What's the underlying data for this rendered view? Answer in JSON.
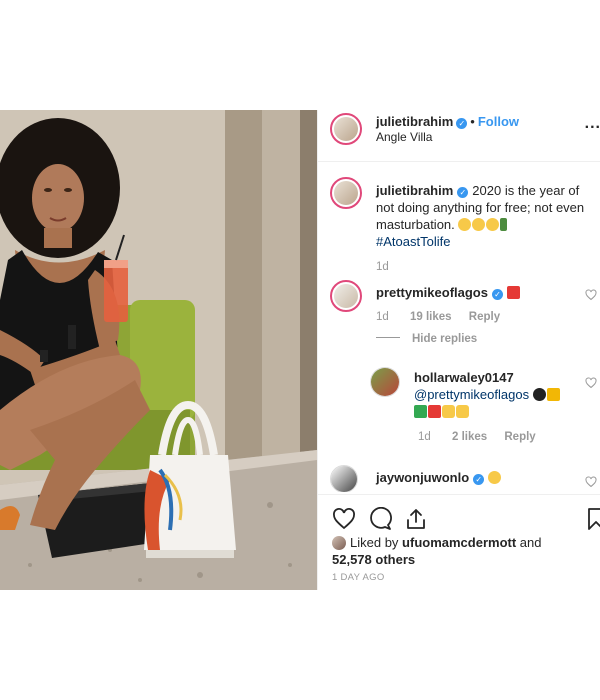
{
  "post": {
    "author": "julietibrahim",
    "follow_label": "Follow",
    "dot": "•",
    "location": "Angle Villa",
    "more_label": "..."
  },
  "caption": {
    "username": "julietibrahim",
    "text": "2020 is the year of not doing anything for free; not even masturbation.",
    "emojis": [
      "thinking-face-emoji",
      "neutral-face-emoji",
      "grinning-face-emoji",
      "bottle-emoji"
    ],
    "hashtag": "#AtoastTolife",
    "time": "1d"
  },
  "comments": [
    {
      "username": "prettymikeoflagos",
      "verified": true,
      "emoji": "hundred-points-emoji",
      "time": "1d",
      "likes": "19 likes",
      "reply_label": "Reply",
      "hide_replies_label": "Hide replies",
      "replies": [
        {
          "username": "hollarwaley0147",
          "mention": "@prettymikeoflagos",
          "emojis": [
            "black-heart-emoji",
            "crown-emoji",
            "check-mark-emoji",
            "hundred-points-emoji",
            "raised-hands-emoji",
            "raised-hands-emoji"
          ],
          "time": "1d",
          "likes": "2 likes",
          "reply_label": "Reply"
        }
      ]
    },
    {
      "username": "jaywonjuwonlo",
      "verified": true,
      "emoji": "grinning-face-emoji"
    }
  ],
  "actions": {
    "icons": [
      "heart-icon",
      "comment-icon",
      "share-icon",
      "bookmark-icon"
    ]
  },
  "likes": {
    "prefix": "Liked by",
    "user": "ufuomamcdermott",
    "and": "and",
    "count": "52,578 others"
  },
  "date": "1 DAY AGO",
  "colors": {
    "link": "#3897f0",
    "hashtag": "#003569",
    "muted": "#999999",
    "border": "#efefef",
    "story_ring": "#e0487a"
  }
}
